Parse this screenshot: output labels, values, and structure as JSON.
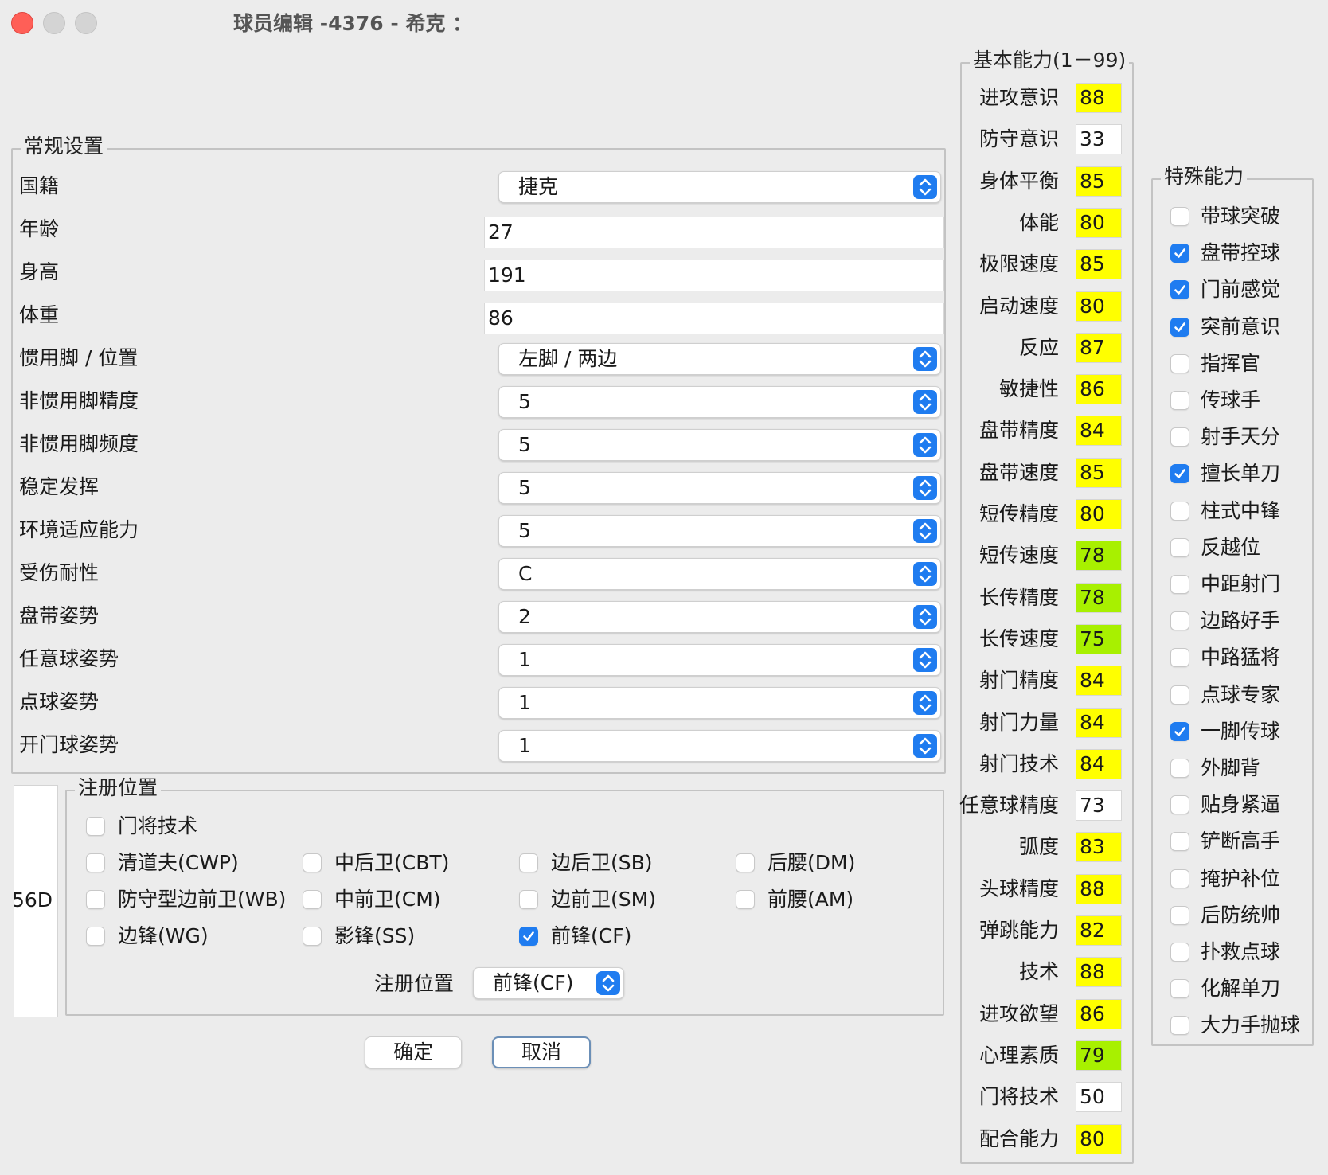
{
  "window": {
    "title": "球员编辑 -4376 - 希克 ："
  },
  "general": {
    "legend": "常规设置",
    "nationality": {
      "label": "国籍",
      "value": "捷克"
    },
    "age": {
      "label": "年龄",
      "value": "27"
    },
    "height": {
      "label": "身高",
      "value": "191"
    },
    "weight": {
      "label": "体重",
      "value": "86"
    },
    "foot_position": {
      "label": "惯用脚 / 位置",
      "value": "左脚 / 两边"
    },
    "weak_foot_accuracy": {
      "label": "非惯用脚精度",
      "value": "5"
    },
    "weak_foot_frequency": {
      "label": "非惯用脚频度",
      "value": "5"
    },
    "consistency": {
      "label": "稳定发挥",
      "value": "5"
    },
    "condition": {
      "label": "环境适应能力",
      "value": "5"
    },
    "injury_tolerance": {
      "label": "受伤耐性",
      "value": "C"
    },
    "dribble_style": {
      "label": "盘带姿势",
      "value": "2"
    },
    "free_kick_style": {
      "label": "任意球姿势",
      "value": "1"
    },
    "penalty_style": {
      "label": "点球姿势",
      "value": "1"
    },
    "goal_kick_style": {
      "label": "开门球姿势",
      "value": "1"
    }
  },
  "side_panel": {
    "partial_text": "56D"
  },
  "registered": {
    "legend": "注册位置",
    "positions": [
      {
        "label": "门将技术",
        "checked": false
      },
      {
        "label": "清道夫(CWP)",
        "checked": false
      },
      {
        "label": "中后卫(CBT)",
        "checked": false
      },
      {
        "label": "边后卫(SB)",
        "checked": false
      },
      {
        "label": "后腰(DM)",
        "checked": false
      },
      {
        "label": "防守型边前卫(WB)",
        "checked": false
      },
      {
        "label": "中前卫(CM)",
        "checked": false
      },
      {
        "label": "边前卫(SM)",
        "checked": false
      },
      {
        "label": "前腰(AM)",
        "checked": false
      },
      {
        "label": "边锋(WG)",
        "checked": false
      },
      {
        "label": "影锋(SS)",
        "checked": false
      },
      {
        "label": "前锋(CF)",
        "checked": true
      }
    ],
    "select_label": "注册位置",
    "select_value": "前锋(CF)"
  },
  "buttons": {
    "ok": "确定",
    "cancel": "取消"
  },
  "abilities": {
    "legend": "基本能力(1－99)",
    "items": [
      {
        "label": "进攻意识",
        "value": "88",
        "color": "#ffff00"
      },
      {
        "label": "防守意识",
        "value": "33",
        "color": "#ffffff"
      },
      {
        "label": "身体平衡",
        "value": "85",
        "color": "#ffff00"
      },
      {
        "label": "体能",
        "value": "80",
        "color": "#ffff00"
      },
      {
        "label": "极限速度",
        "value": "85",
        "color": "#ffff00"
      },
      {
        "label": "启动速度",
        "value": "80",
        "color": "#ffff00"
      },
      {
        "label": "反应",
        "value": "87",
        "color": "#ffff00"
      },
      {
        "label": "敏捷性",
        "value": "86",
        "color": "#ffff00"
      },
      {
        "label": "盘带精度",
        "value": "84",
        "color": "#ffff00"
      },
      {
        "label": "盘带速度",
        "value": "85",
        "color": "#ffff00"
      },
      {
        "label": "短传精度",
        "value": "80",
        "color": "#ffff00"
      },
      {
        "label": "短传速度",
        "value": "78",
        "color": "#a8f000"
      },
      {
        "label": "长传精度",
        "value": "78",
        "color": "#a8f000"
      },
      {
        "label": "长传速度",
        "value": "75",
        "color": "#a8f000"
      },
      {
        "label": "射门精度",
        "value": "84",
        "color": "#ffff00"
      },
      {
        "label": "射门力量",
        "value": "84",
        "color": "#ffff00"
      },
      {
        "label": "射门技术",
        "value": "84",
        "color": "#ffff00"
      },
      {
        "label": "任意球精度",
        "value": "73",
        "color": "#ffffff"
      },
      {
        "label": "弧度",
        "value": "83",
        "color": "#ffff00"
      },
      {
        "label": "头球精度",
        "value": "88",
        "color": "#ffff00"
      },
      {
        "label": "弹跳能力",
        "value": "82",
        "color": "#ffff00"
      },
      {
        "label": "技术",
        "value": "88",
        "color": "#ffff00"
      },
      {
        "label": "进攻欲望",
        "value": "86",
        "color": "#ffff00"
      },
      {
        "label": "心理素质",
        "value": "79",
        "color": "#a8f000"
      },
      {
        "label": "门将技术",
        "value": "50",
        "color": "#ffffff"
      },
      {
        "label": "配合能力",
        "value": "80",
        "color": "#ffff00"
      }
    ]
  },
  "specials": {
    "legend": "特殊能力",
    "items": [
      {
        "label": "带球突破",
        "checked": false
      },
      {
        "label": "盘带控球",
        "checked": true
      },
      {
        "label": "门前感觉",
        "checked": true
      },
      {
        "label": "突前意识",
        "checked": true
      },
      {
        "label": "指挥官",
        "checked": false
      },
      {
        "label": "传球手",
        "checked": false
      },
      {
        "label": "射手天分",
        "checked": false
      },
      {
        "label": "擅长单刀",
        "checked": true
      },
      {
        "label": "柱式中锋",
        "checked": false
      },
      {
        "label": "反越位",
        "checked": false
      },
      {
        "label": "中距射门",
        "checked": false
      },
      {
        "label": "边路好手",
        "checked": false
      },
      {
        "label": "中路猛将",
        "checked": false
      },
      {
        "label": "点球专家",
        "checked": false
      },
      {
        "label": "一脚传球",
        "checked": true
      },
      {
        "label": "外脚背",
        "checked": false
      },
      {
        "label": "贴身紧逼",
        "checked": false
      },
      {
        "label": "铲断高手",
        "checked": false
      },
      {
        "label": "掩护补位",
        "checked": false
      },
      {
        "label": "后防统帅",
        "checked": false
      },
      {
        "label": "扑救点球",
        "checked": false
      },
      {
        "label": "化解单刀",
        "checked": false
      },
      {
        "label": "大力手抛球",
        "checked": false
      }
    ]
  }
}
